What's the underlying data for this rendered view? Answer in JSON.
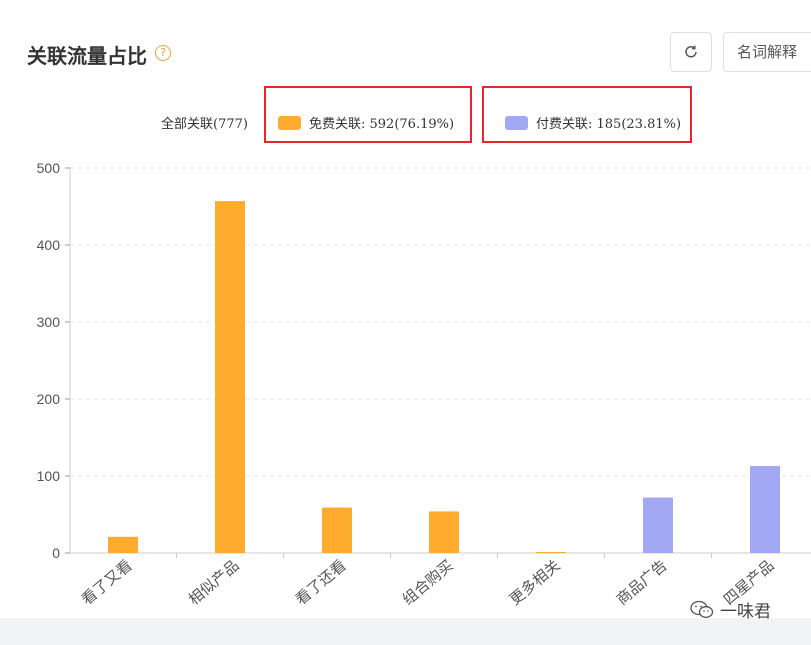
{
  "header": {
    "title": "关联流量占比",
    "help_glyph": "?",
    "glossary_label": "名词解释"
  },
  "legend": {
    "all_label": "全部关联(777)",
    "items": [
      {
        "label": "免费关联: 592(76.19%)",
        "color": "#ffab2e"
      },
      {
        "label": "付费关联: 185(23.81%)",
        "color": "#a3a8f5"
      }
    ]
  },
  "chart_data": {
    "type": "bar",
    "categories": [
      "看了又看",
      "相似产品",
      "看了还看",
      "组合购买",
      "更多相关",
      "商品广告",
      "四星产品"
    ],
    "values": [
      21,
      457,
      59,
      54,
      1,
      72,
      113
    ],
    "bar_colors": [
      "#ffab2e",
      "#ffab2e",
      "#ffab2e",
      "#ffab2e",
      "#ffab2e",
      "#a3a8f5",
      "#a3a8f5"
    ],
    "ylim": [
      0,
      500
    ],
    "yticks": [
      "0",
      "100",
      "200",
      "300",
      "400",
      "500"
    ],
    "grid": true,
    "title": "",
    "xlabel": "",
    "ylabel": ""
  },
  "watermark": {
    "text": "一味君"
  }
}
